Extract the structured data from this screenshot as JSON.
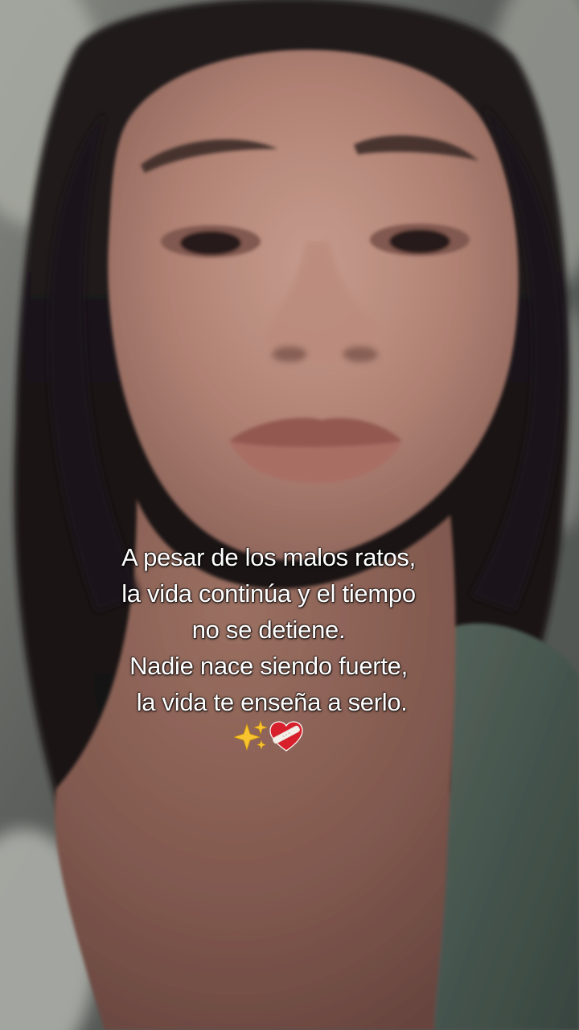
{
  "caption": {
    "lines": [
      "A pesar de los malos ratos,",
      "la vida continúa y el tiempo",
      "no se detiene.",
      "Nadie nace siendo fuerte,",
      " la vida te enseña a serlo."
    ],
    "emojis": [
      "sparkles-emoji",
      "mending-heart-emoji"
    ]
  },
  "colors": {
    "caption_text": "#ffffff",
    "sparkle": "#f7c32e",
    "heart": "#d8202c",
    "bandage": "#f4efe8",
    "sweater": "#4a5a52",
    "hair": "#1f1a1a",
    "skin": "#b98878"
  }
}
